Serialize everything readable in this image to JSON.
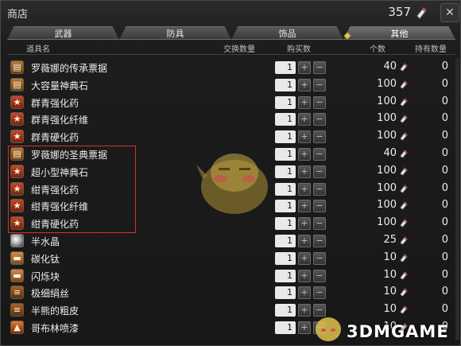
{
  "window": {
    "title": "商店",
    "currency_amount": "357",
    "currency_icon": "gil-crystal-icon",
    "close_icon": "close-icon"
  },
  "tabs": [
    {
      "label": "武器",
      "active": false
    },
    {
      "label": "防具",
      "active": false
    },
    {
      "label": "饰品",
      "active": false
    },
    {
      "label": "其他",
      "active": true
    }
  ],
  "columns": {
    "item_name": "道具名",
    "exchange_qty": "交换数量",
    "purchase_qty": "购买数",
    "count": "个数",
    "owned": "持有数量"
  },
  "items": [
    {
      "icon": "ticket-icon",
      "name": "罗薇娜的传承票据",
      "qty": "1",
      "count": "40",
      "owned": "0"
    },
    {
      "icon": "ticket-icon",
      "name": "大容量神典石",
      "qty": "1",
      "count": "100",
      "owned": "0"
    },
    {
      "icon": "star-icon",
      "name": "群青强化药",
      "qty": "1",
      "count": "100",
      "owned": "0"
    },
    {
      "icon": "star-icon",
      "name": "群青强化纤维",
      "qty": "1",
      "count": "100",
      "owned": "0"
    },
    {
      "icon": "star-icon",
      "name": "群青硬化药",
      "qty": "1",
      "count": "100",
      "owned": "0"
    },
    {
      "icon": "ticket-icon",
      "name": "罗薇娜的圣典票据",
      "qty": "1",
      "count": "40",
      "owned": "0"
    },
    {
      "icon": "star-icon",
      "name": "超小型神典石",
      "qty": "1",
      "count": "100",
      "owned": "0"
    },
    {
      "icon": "star-icon",
      "name": "绀青强化药",
      "qty": "1",
      "count": "100",
      "owned": "0"
    },
    {
      "icon": "star-icon",
      "name": "绀青强化纤维",
      "qty": "1",
      "count": "100",
      "owned": "0"
    },
    {
      "icon": "star-icon",
      "name": "绀青硬化药",
      "qty": "1",
      "count": "100",
      "owned": "0"
    },
    {
      "icon": "orb-icon",
      "name": "半水晶",
      "qty": "1",
      "count": "25",
      "owned": "0"
    },
    {
      "icon": "ingot-icon",
      "name": "碳化钛",
      "qty": "1",
      "count": "10",
      "owned": "0"
    },
    {
      "icon": "ingot-icon",
      "name": "闪烁块",
      "qty": "1",
      "count": "10",
      "owned": "0"
    },
    {
      "icon": "scroll-icon",
      "name": "极细绢丝",
      "qty": "1",
      "count": "10",
      "owned": "0"
    },
    {
      "icon": "scroll-icon",
      "name": "半熊的粗皮",
      "qty": "1",
      "count": "10",
      "owned": "0"
    },
    {
      "icon": "fire-icon",
      "name": "哥布林喷漆",
      "qty": "1",
      "count": "10",
      "owned": "0"
    }
  ],
  "watermark": {
    "text": "3DMGAME"
  },
  "colors": {
    "highlight_box": "#d4342b",
    "active_tab_marker": "#e9c24a"
  }
}
